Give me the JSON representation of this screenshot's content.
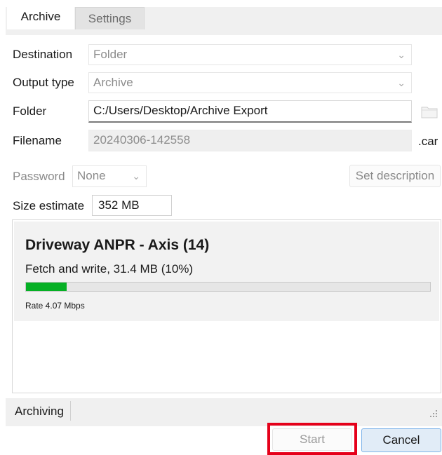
{
  "tabs": {
    "archive_label": "Archive",
    "settings_label": "Settings"
  },
  "form": {
    "destination_label": "Destination",
    "destination_value": "Folder",
    "output_type_label": "Output type",
    "output_type_value": "Archive",
    "folder_label": "Folder",
    "folder_value": "C:/Users/Desktop/Archive Export",
    "filename_label": "Filename",
    "filename_value": "20240306-142558",
    "filename_ext": ".car",
    "password_label": "Password",
    "password_value": "None",
    "set_description_label": "Set description",
    "size_estimate_label": "Size estimate",
    "size_estimate_value": "352 MB"
  },
  "progress": {
    "job_title": "Driveway ANPR - Axis (14)",
    "status_text": "Fetch and write, 31.4 MB (10%)",
    "percent": 10,
    "rate_text": "Rate 4.07 Mbps"
  },
  "statusbar": {
    "text": "Archiving"
  },
  "buttons": {
    "start_label": "Start",
    "cancel_label": "Cancel"
  },
  "icons": {
    "folder_browse": "folder-icon",
    "dropdown": "chevron-down-icon"
  },
  "colors": {
    "progress_fill": "#06b025",
    "highlight": "#e5001a",
    "cancel_border": "#7eb4ea"
  }
}
